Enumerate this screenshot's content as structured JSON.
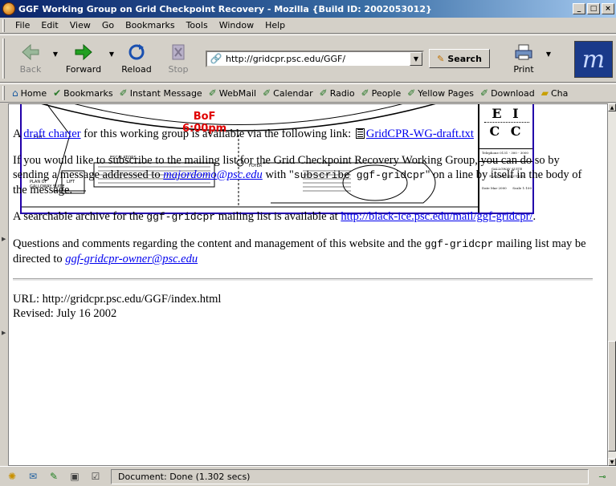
{
  "window": {
    "title": "GGF Working Group on Grid Checkpoint Recovery - Mozilla {Build ID: 2002053012}",
    "minimize": "_",
    "maximize": "□",
    "close": "×"
  },
  "menu": [
    "File",
    "Edit",
    "View",
    "Go",
    "Bookmarks",
    "Tools",
    "Window",
    "Help"
  ],
  "nav": {
    "back": "Back",
    "forward": "Forward",
    "reload": "Reload",
    "stop": "Stop",
    "url": "http://gridcpr.psc.edu/GGF/",
    "search": "Search",
    "print": "Print"
  },
  "personal_toolbar": [
    "Home",
    "Bookmarks",
    "Instant Message",
    "WebMail",
    "Calendar",
    "Radio",
    "People",
    "Yellow Pages",
    "Download",
    "Cha"
  ],
  "floorplan": {
    "bof": "BoF",
    "time": "6:00pm",
    "labels": [
      "EXIT",
      "ESCALATORS",
      "FOYER",
      "PLAN OF GALLOWAY SUITE",
      "LIFT"
    ],
    "title_block": {
      "logo_top": "E I",
      "logo_bottom": "C C",
      "telephone": "Telephone 0131 - 300 - 3000",
      "suite": "GALLOWAY SUITE",
      "plan": "PLAN AND SECTION",
      "date": "Date Mar 2000",
      "scale": "Scale 1:100"
    }
  },
  "content": {
    "p1": {
      "pre": "A ",
      "link": "draft charter",
      "mid": " for this working group is available via the following link: ",
      "file_link": "GridCPR-WG-draft.txt"
    },
    "p2": {
      "pre": "If you would like to subscribe to the mailing list for the Grid Checkpoint Recovery Working Group, you can do so by sending a message addressed to ",
      "email": "majordomo@psc.edu",
      "mid": " with \"",
      "code": "subscribe ggf-gridcpr",
      "post": "\" on a line by itself in the body of the message."
    },
    "p3": {
      "pre": "A searchable archive for the ",
      "code": "ggf-gridcpr",
      "mid": " mailing list is available at ",
      "link": "http://black-ice.psc.edu/mail/ggf-gridcpr/",
      "post": "."
    },
    "p4": {
      "pre": "Questions and comments regarding the content and management of this website and the ",
      "code": "ggf-gridcpr",
      "mid": " mailing list may be directed to ",
      "email": "ggf-gridcpr-owner@psc.edu"
    },
    "footer_url": "URL: http://gridcpr.psc.edu/GGF/index.html",
    "footer_revised": "Revised: July 16 2002"
  },
  "status": {
    "text": "Document: Done (1.302 secs)"
  }
}
